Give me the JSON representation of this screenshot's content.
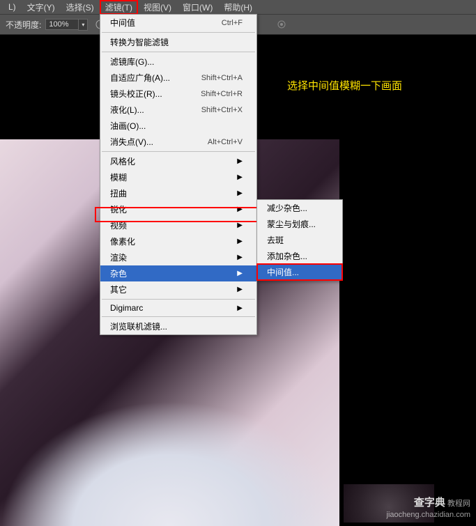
{
  "menubar": {
    "items": [
      {
        "label": "L)"
      },
      {
        "label": "文字(Y)"
      },
      {
        "label": "选择(S)"
      },
      {
        "label": "滤镜(T)",
        "highlighted": true
      },
      {
        "label": "视图(V)"
      },
      {
        "label": "窗口(W)"
      },
      {
        "label": "帮助(H)"
      }
    ]
  },
  "toolbar": {
    "opacity_label": "不透明度:",
    "opacity_value": "100%"
  },
  "annotation": "选择中间值模糊一下画面",
  "filter_menu": {
    "items": [
      {
        "label": "中间值",
        "shortcut": "Ctrl+F"
      },
      {
        "label": "转换为智能滤镜"
      },
      {
        "label": "滤镜库(G)..."
      },
      {
        "label": "自适应广角(A)...",
        "shortcut": "Shift+Ctrl+A"
      },
      {
        "label": "镜头校正(R)...",
        "shortcut": "Shift+Ctrl+R"
      },
      {
        "label": "液化(L)...",
        "shortcut": "Shift+Ctrl+X"
      },
      {
        "label": "油画(O)..."
      },
      {
        "label": "消失点(V)...",
        "shortcut": "Alt+Ctrl+V"
      },
      {
        "label": "风格化",
        "arrow": true
      },
      {
        "label": "模糊",
        "arrow": true
      },
      {
        "label": "扭曲",
        "arrow": true
      },
      {
        "label": "锐化",
        "arrow": true
      },
      {
        "label": "视频",
        "arrow": true
      },
      {
        "label": "像素化",
        "arrow": true
      },
      {
        "label": "渲染",
        "arrow": true
      },
      {
        "label": "杂色",
        "arrow": true,
        "selected": true,
        "highlighted": true
      },
      {
        "label": "其它",
        "arrow": true
      },
      {
        "label": "Digimarc",
        "arrow": true
      },
      {
        "label": "浏览联机滤镜..."
      }
    ]
  },
  "noise_submenu": {
    "items": [
      {
        "label": "减少杂色..."
      },
      {
        "label": "蒙尘与划痕..."
      },
      {
        "label": "去斑"
      },
      {
        "label": "添加杂色..."
      },
      {
        "label": "中间值...",
        "selected": true,
        "highlighted": true
      }
    ]
  },
  "watermark": {
    "big": "查字典",
    "small": "教程网",
    "url": "jiaocheng.chazidian.com"
  }
}
